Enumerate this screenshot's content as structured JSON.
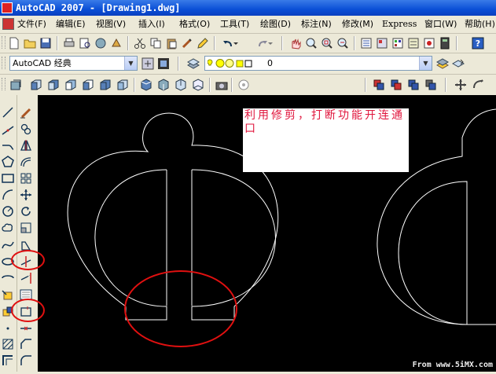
{
  "window": {
    "title": "AutoCAD 2007 - [Drawing1.dwg]"
  },
  "menu": [
    {
      "label": "文件(F)"
    },
    {
      "label": "编辑(E)"
    },
    {
      "label": "视图(V)"
    },
    {
      "label": "插入(I)"
    },
    {
      "label": "格式(O)"
    },
    {
      "label": "工具(T)"
    },
    {
      "label": "绘图(D)"
    },
    {
      "label": "标注(N)"
    },
    {
      "label": "修改(M)"
    },
    {
      "label": "Express"
    },
    {
      "label": "窗口(W)"
    },
    {
      "label": "帮助(H)"
    }
  ],
  "workspace": {
    "value": "AutoCAD 经典"
  },
  "layer": {
    "value": "0"
  },
  "annotation": {
    "text": "利用修剪，打断功能开连通口"
  },
  "watermark": {
    "text": "From www.5iMX.com"
  },
  "colors": {
    "accent_circle": "#e01010",
    "annotation_text": "#e0153c",
    "canvas": "#000000"
  }
}
